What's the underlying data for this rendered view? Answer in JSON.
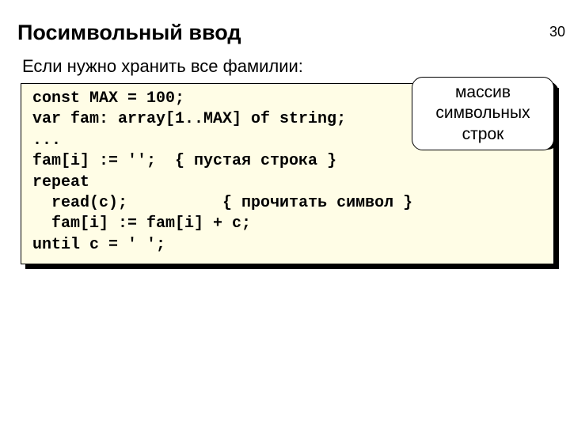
{
  "page_number": "30",
  "title": "Посимвольный ввод",
  "subtitle": "Если нужно хранить все фамилии:",
  "callout": "массив символьных строк",
  "code": {
    "l1": "const MAX = 100;",
    "l2": "var fam: array[1..MAX] of string;",
    "l3": "...",
    "l4a": "fam[i] := '';  ",
    "l4b": "{ пустая строка }",
    "l5": "repeat",
    "l6a": "  read(c);          ",
    "l6b": "{ прочитать символ }",
    "l7": "  fam[i] := fam[i] + c;",
    "l8": "until c = ' ';"
  }
}
